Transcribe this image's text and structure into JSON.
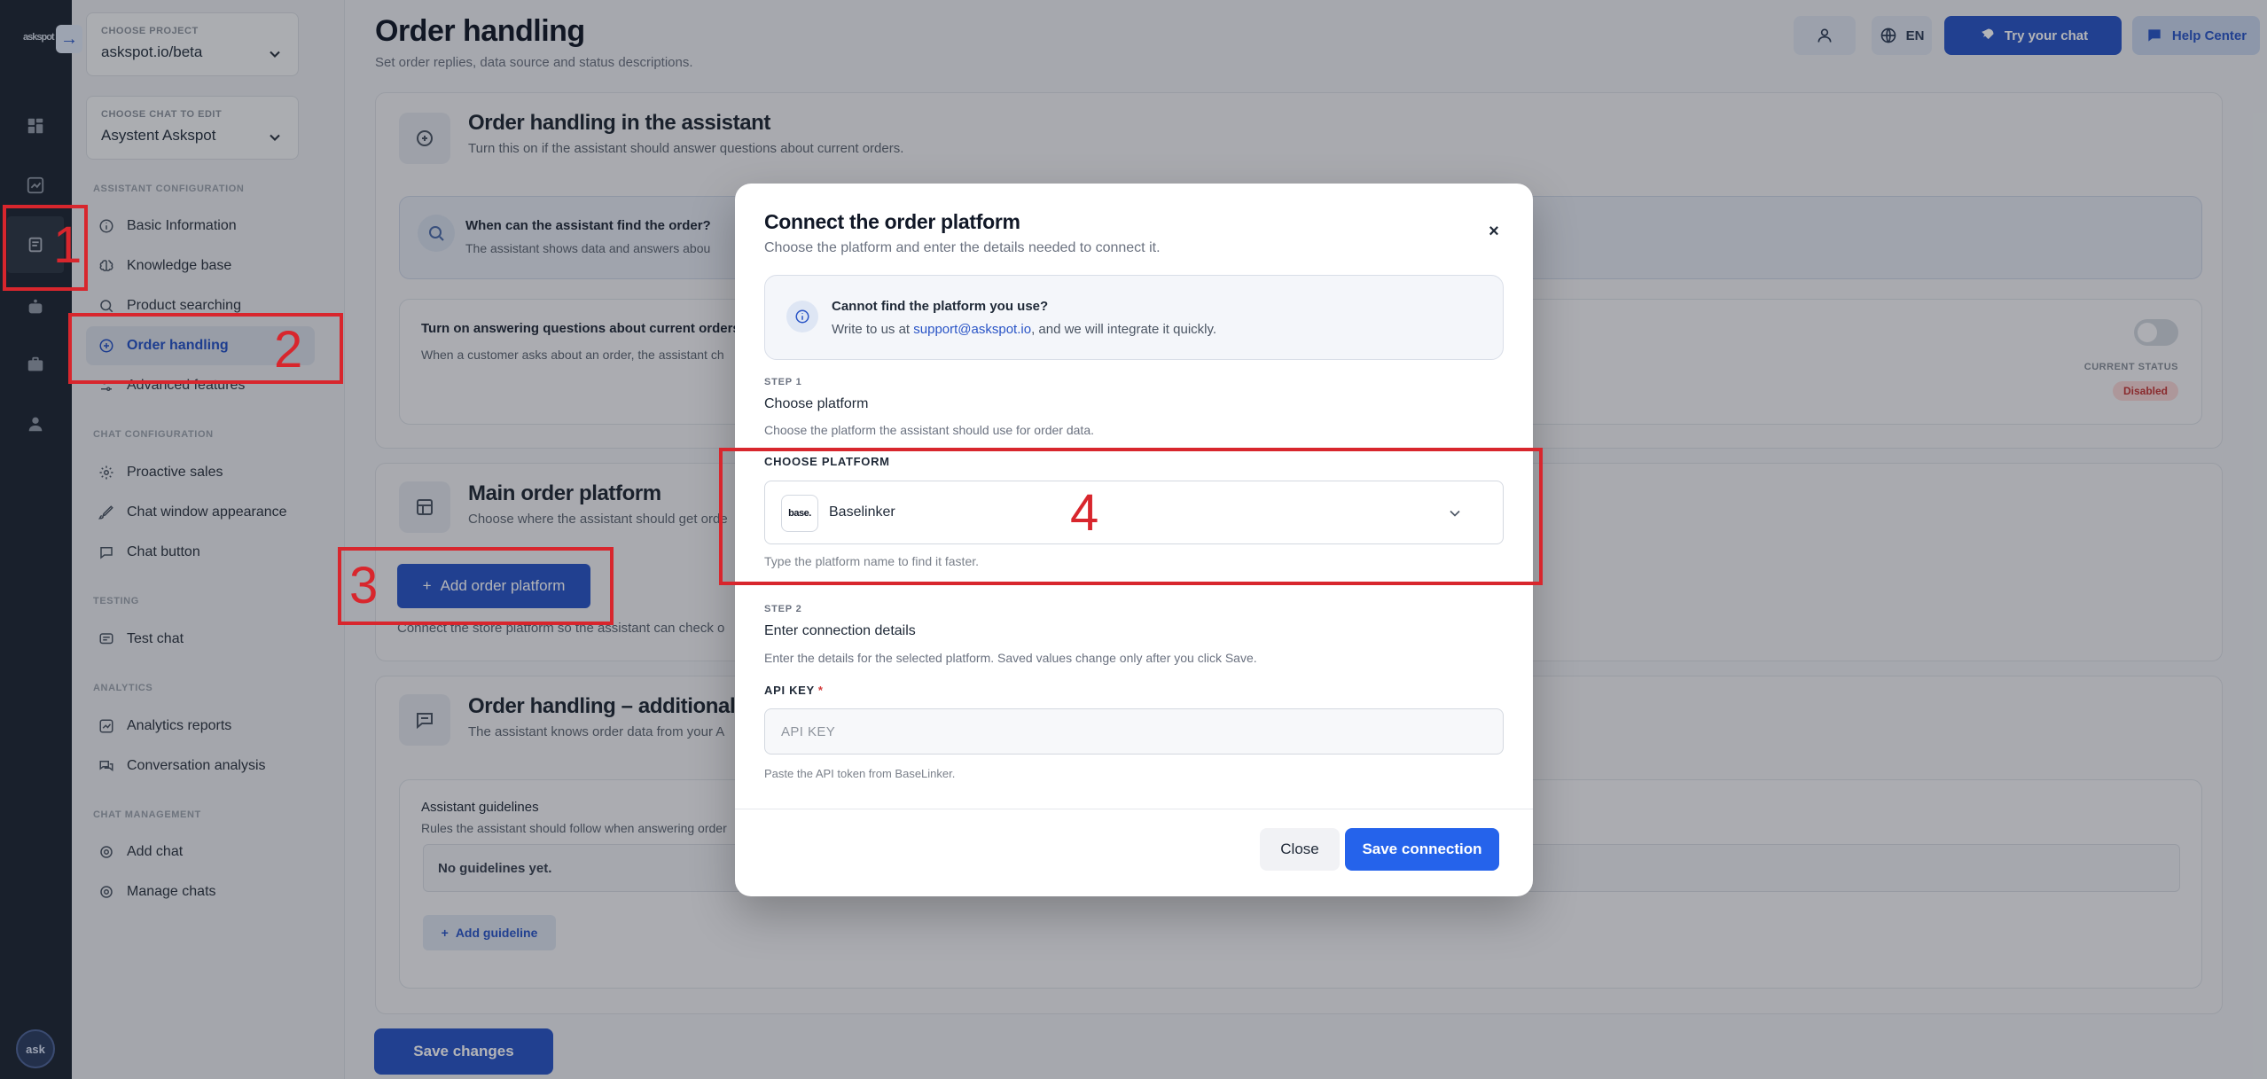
{
  "rail": {
    "logo": "askspot",
    "collapse_glyph": "→",
    "avatar_text": "ask",
    "icons": [
      "dashboard-icon",
      "analytics-icon",
      "document-icon",
      "bot-icon",
      "briefcase-icon",
      "user-icon"
    ]
  },
  "sidebar": {
    "project": {
      "caption": "CHOOSE PROJECT",
      "value": "askspot.io/beta"
    },
    "chat": {
      "caption": "CHOOSE CHAT TO EDIT",
      "value": "Asystent Askspot"
    },
    "sections": {
      "assistant": "ASSISTANT CONFIGURATION",
      "chat": "CHAT CONFIGURATION",
      "testing": "TESTING",
      "analytics": "ANALYTICS",
      "management": "CHAT MANAGEMENT"
    },
    "items": {
      "basic": "Basic Information",
      "knowledge": "Knowledge base",
      "product": "Product searching",
      "order": "Order handling",
      "advanced": "Advanced features",
      "proactive": "Proactive sales",
      "appearance": "Chat window appearance",
      "button": "Chat button",
      "test": "Test chat",
      "reports": "Analytics reports",
      "conversation": "Conversation analysis",
      "add": "Add chat",
      "manage": "Manage chats"
    }
  },
  "header": {
    "title": "Order handling",
    "subtitle": "Set order replies, data source and status descriptions.",
    "lang": "EN",
    "try_chat": "Try your chat",
    "help": "Help Center"
  },
  "section1": {
    "title": "Order handling in the assistant",
    "subtitle": "Turn this on if the assistant should answer questions about current orders.",
    "info_title": "When can the assistant find the order?",
    "info_text": "The assistant shows data and answers abou",
    "toggle_title": "Turn on answering questions about current orders",
    "toggle_text": "When a customer asks about an order, the assistant ch",
    "status_label": "CURRENT STATUS",
    "status_value": "Disabled"
  },
  "section2": {
    "title": "Main order platform",
    "subtitle": "Choose where the assistant should get orde",
    "add_button": "Add order platform",
    "note": "Connect the store platform so the assistant can check o"
  },
  "section3": {
    "title": "Order handling – additional in",
    "subtitle": "The assistant knows order data from your A",
    "guidelines_title": "Assistant guidelines",
    "guidelines_text": "Rules the assistant should follow when answering order",
    "empty": "No guidelines yet.",
    "add": "Add guideline"
  },
  "footer": {
    "save": "Save changes"
  },
  "modal": {
    "title": "Connect the order platform",
    "subtitle": "Choose the platform and enter the details needed to connect it.",
    "close_glyph": "×",
    "info": {
      "title": "Cannot find the platform you use?",
      "prefix": "Write to us at ",
      "email": "support@askspot.io",
      "suffix": ", and we will integrate it quickly."
    },
    "step1": {
      "label": "STEP 1",
      "heading": "Choose platform",
      "desc": "Choose the platform the assistant should use for order data.",
      "field_label": "CHOOSE PLATFORM",
      "selected_logo": "base.",
      "selected": "Baselinker",
      "hint": "Type the platform name to find it faster."
    },
    "step2": {
      "label": "STEP 2",
      "heading": "Enter connection details",
      "desc": "Enter the details for the selected platform. Saved values change only after you click Save.",
      "field_label": "API KEY",
      "required": "*",
      "placeholder": "API KEY",
      "hint": "Paste the API token from BaseLinker."
    },
    "close": "Close",
    "save": "Save connection"
  },
  "annotations": [
    "1",
    "2",
    "3",
    "4"
  ]
}
